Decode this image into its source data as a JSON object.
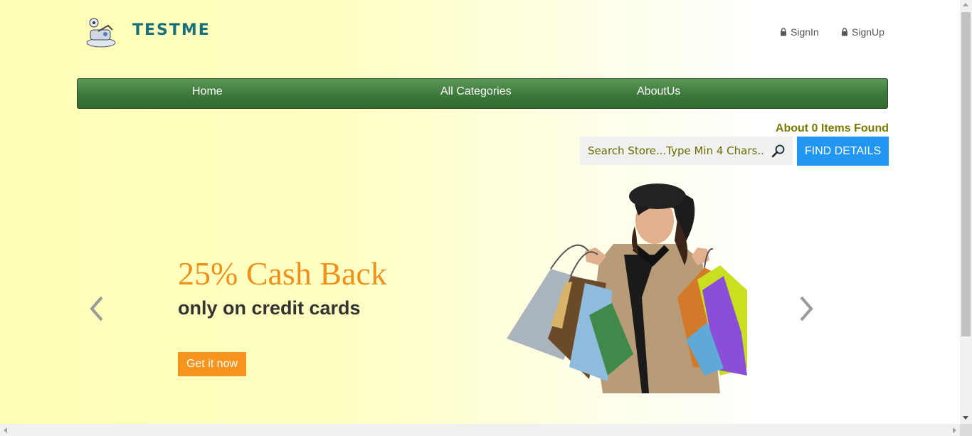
{
  "header": {
    "brand": "TESTME",
    "signin_label": "SignIn",
    "signup_label": "SignUp"
  },
  "nav": {
    "items": [
      {
        "label": "Home"
      },
      {
        "label": "All Categories"
      },
      {
        "label": "AboutUs"
      }
    ]
  },
  "search": {
    "results_text": "About 0 Items Found",
    "placeholder": "Search Store...Type Min 4 Chars...",
    "value": "",
    "button_label": "FIND DETAILS"
  },
  "carousel": {
    "headline": "25% Cash Back",
    "subline": "only on credit cards",
    "cta_label": "Get it now"
  },
  "colors": {
    "nav": "#3f7a3c",
    "accent_orange": "#f7941d",
    "button_blue": "#2196f3",
    "brand_teal": "#17707a"
  },
  "icons": [
    "logo-icon",
    "lock-icon",
    "search-icon",
    "chevron-left-icon",
    "chevron-right-icon"
  ]
}
